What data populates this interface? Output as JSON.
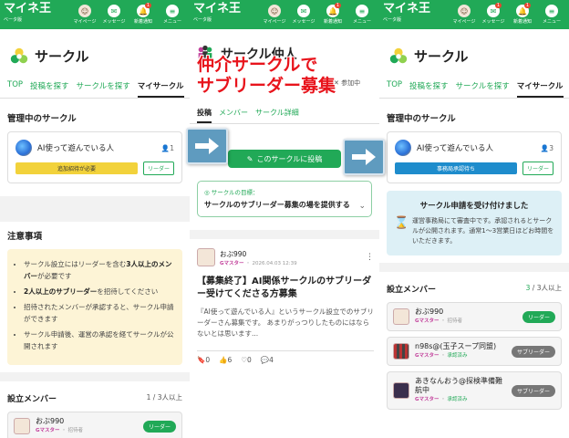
{
  "nav": {
    "logo": "マイネ王",
    "logo_sub": "ベータ版",
    "items": [
      {
        "label": "マイページ",
        "icon": "avatar-icon"
      },
      {
        "label": "メッセージ",
        "icon": "mail-icon"
      },
      {
        "label": "新着通知",
        "icon": "bell-icon"
      },
      {
        "label": "メニュー",
        "icon": "menu-icon"
      }
    ],
    "message_badge": "1",
    "notify_badge": "1"
  },
  "left": {
    "title": "サークル",
    "tabs": [
      "TOP",
      "投稿を探す",
      "サークルを探す",
      "マイサークル"
    ],
    "managed_title": "管理中のサークル",
    "circle_name": "AI使って遊んでいる人",
    "member_count": "1",
    "status_pill": "追加招待が必要",
    "role_pill": "リーダー",
    "notice_title": "注意事項",
    "notes": [
      {
        "pre": "サークル設立にはリーダーを含む",
        "bold": "3人以上のメンバー",
        "post": "が必要です"
      },
      {
        "pre": "",
        "bold": "2人以上のサブリーダー",
        "post": "を招待してください"
      },
      {
        "pre": "招待されたメンバーが承認すると、サークル申請ができます",
        "bold": "",
        "post": ""
      },
      {
        "pre": "サークル申請後、運営の承認を経てサークルが公開されます",
        "bold": "",
        "post": ""
      }
    ],
    "members_title": "設立メンバー",
    "members_count": "1 / 3人以上",
    "member": {
      "name": "おぶ990",
      "rank": "Gマスター",
      "role": "招待者",
      "pill": "リーダー"
    }
  },
  "middle": {
    "title": "サークル仲人",
    "overlay_line1": "仲介サークルで",
    "overlay_line2": "サブリーダー募集",
    "join_label": "参加中",
    "tabs": [
      "投稿",
      "メンバー",
      "サークル詳細"
    ],
    "post_button": "このサークルに投稿",
    "goal_label": "サークルの目標：",
    "goal_text": "サークルのサブリーダー募集の場を提供する",
    "post": {
      "author": "おぶ990",
      "rank": "Gマスター",
      "date": "2026.04.03 12:39",
      "title": "【募集終了】AI関係サークルのサブリーダー受けてくださる方募集",
      "body": "『AI使って遊んでいる人』というサークル設立でのサブリーダーさん募集です。 あまりがっつりしたものにはならないとは思います...",
      "stats": {
        "bookmark": "0",
        "like": "6",
        "heart": "0",
        "comment": "4"
      }
    }
  },
  "right": {
    "title": "サークル",
    "tabs": [
      "TOP",
      "投稿を探す",
      "サークルを探す",
      "マイサークル"
    ],
    "managed_title": "管理中のサークル",
    "circle_name": "AI使って遊んでいる人",
    "member_count": "3",
    "status_pill": "事務局承認待ち",
    "role_pill": "リーダー",
    "info_title": "サークル申請を受け付けました",
    "info_text": "運営事務局にて審査中です。承認されるとサークルが公開されます。通常1〜3営業日ほどお時間をいただきます。",
    "members_title": "設立メンバー",
    "members_count_num": "3",
    "members_count_rest": " / 3人以上",
    "members": [
      {
        "name": "おぶ990",
        "rank": "Gマスター",
        "role": "招待者",
        "pill": "リーダー"
      },
      {
        "name": "n98s@(玉子スープ同盟)",
        "rank": "Gマスター",
        "role": "承認済み",
        "pill": "サブリーダー"
      },
      {
        "name": "あきなんおう@探検準備難航中",
        "rank": "Gマスター",
        "role": "承認済み",
        "pill": "サブリーダー"
      }
    ]
  },
  "colors": {
    "brand": "#21a957",
    "overlay": "#e8141c",
    "notice": "#fdf4d6",
    "info": "#ddf0f6"
  }
}
